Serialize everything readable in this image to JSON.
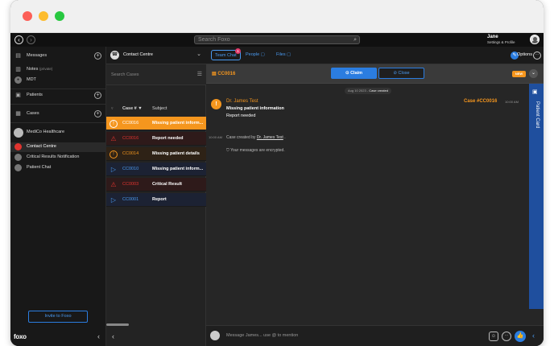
{
  "header": {
    "search_placeholder": "Search Foxo",
    "user_name": "Jane",
    "user_sub": "Settings & Profile"
  },
  "sidebar": {
    "messages": "Messages",
    "notes": "Notes",
    "notes_private": "(private)",
    "mdt": "MDT",
    "patients": "Patients",
    "cases": "Cases",
    "org": "MediCo Healthcare",
    "items": [
      {
        "label": "Contact Centre"
      },
      {
        "label": "Critical Results Notification"
      },
      {
        "label": "Patient Chat"
      }
    ],
    "invite": "Invite to Foxo",
    "logo": "foxo"
  },
  "middle": {
    "channel": "Contact Centre",
    "search_placeholder": "Search Cases",
    "col_case": "Case # ▼",
    "col_subject": "Subject",
    "rows": [
      {
        "id": "CC0016",
        "subject": "Missing patient inform..."
      },
      {
        "id": "CC0016",
        "subject": "Report needed"
      },
      {
        "id": "CC0014",
        "subject": "Missing patient details"
      },
      {
        "id": "CC0010",
        "subject": "Missing patient inform..."
      },
      {
        "id": "CC0003",
        "subject": "Critical Result"
      },
      {
        "id": "CC0001",
        "subject": "Report"
      }
    ]
  },
  "tabs": {
    "team_chat": "Team Chat",
    "team_badge": "1",
    "people": "People",
    "files": "Files",
    "options": "Options"
  },
  "case_bar": {
    "id": "CC0016",
    "claim": "Claim",
    "close": "Close",
    "badge": "NEW"
  },
  "chat": {
    "date": "Aug 10 2023 -",
    "date_event": "Case created",
    "author": "Dr. James Test",
    "line1": "Missing patient information",
    "line2": "Report needed",
    "case_ref": "Case #CC0016",
    "time": "10:00 AM",
    "sys_time": "10:00 AM",
    "sys_prefix": "Case created by",
    "sys_user": "Dr. James Test",
    "sys_suffix": ".",
    "encrypted": "Your messages are encrypted."
  },
  "patient_card": "Patient Card",
  "composer": {
    "placeholder": "Message James... use @ to mention"
  },
  "colors": {
    "accent": "#2b7de0",
    "orange": "#f5961e",
    "red": "#e0342f",
    "blue": "#4a9af0"
  }
}
